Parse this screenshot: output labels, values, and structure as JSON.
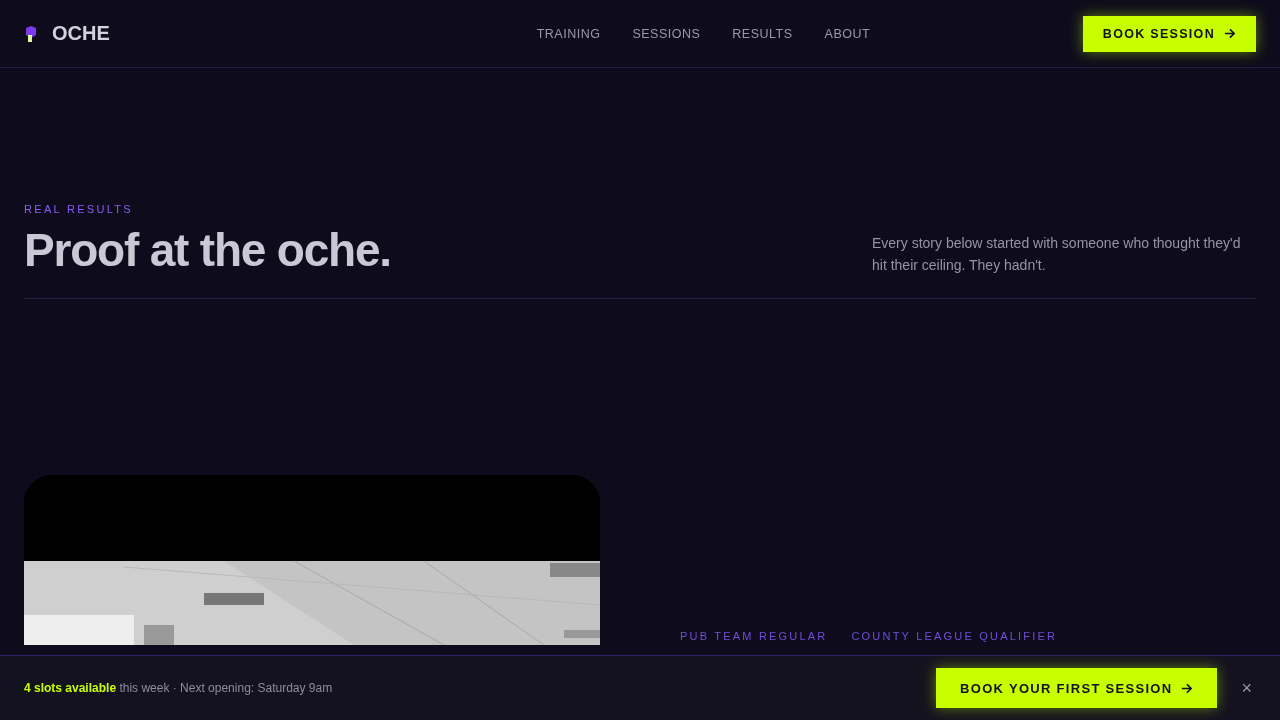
{
  "header": {
    "brand": "OCHE",
    "nav": [
      {
        "label": "TRAINING"
      },
      {
        "label": "SESSIONS"
      },
      {
        "label": "RESULTS"
      },
      {
        "label": "ABOUT"
      }
    ],
    "cta": "BOOK SESSION"
  },
  "hero": {
    "eyebrow": "REAL RESULTS",
    "title": "Proof at the oche.",
    "intro": "Every story below started with someone who thought they'd hit their ceiling. They hadn't."
  },
  "story": {
    "tags": [
      "PUB TEAM REGULAR",
      "COUNTY LEAGUE QUALIFIER"
    ]
  },
  "booking_bar": {
    "message": "**4 slots available** this week · Next opening: Saturday 9am",
    "cta": "BOOK YOUR FIRST SESSION",
    "close": "×"
  }
}
